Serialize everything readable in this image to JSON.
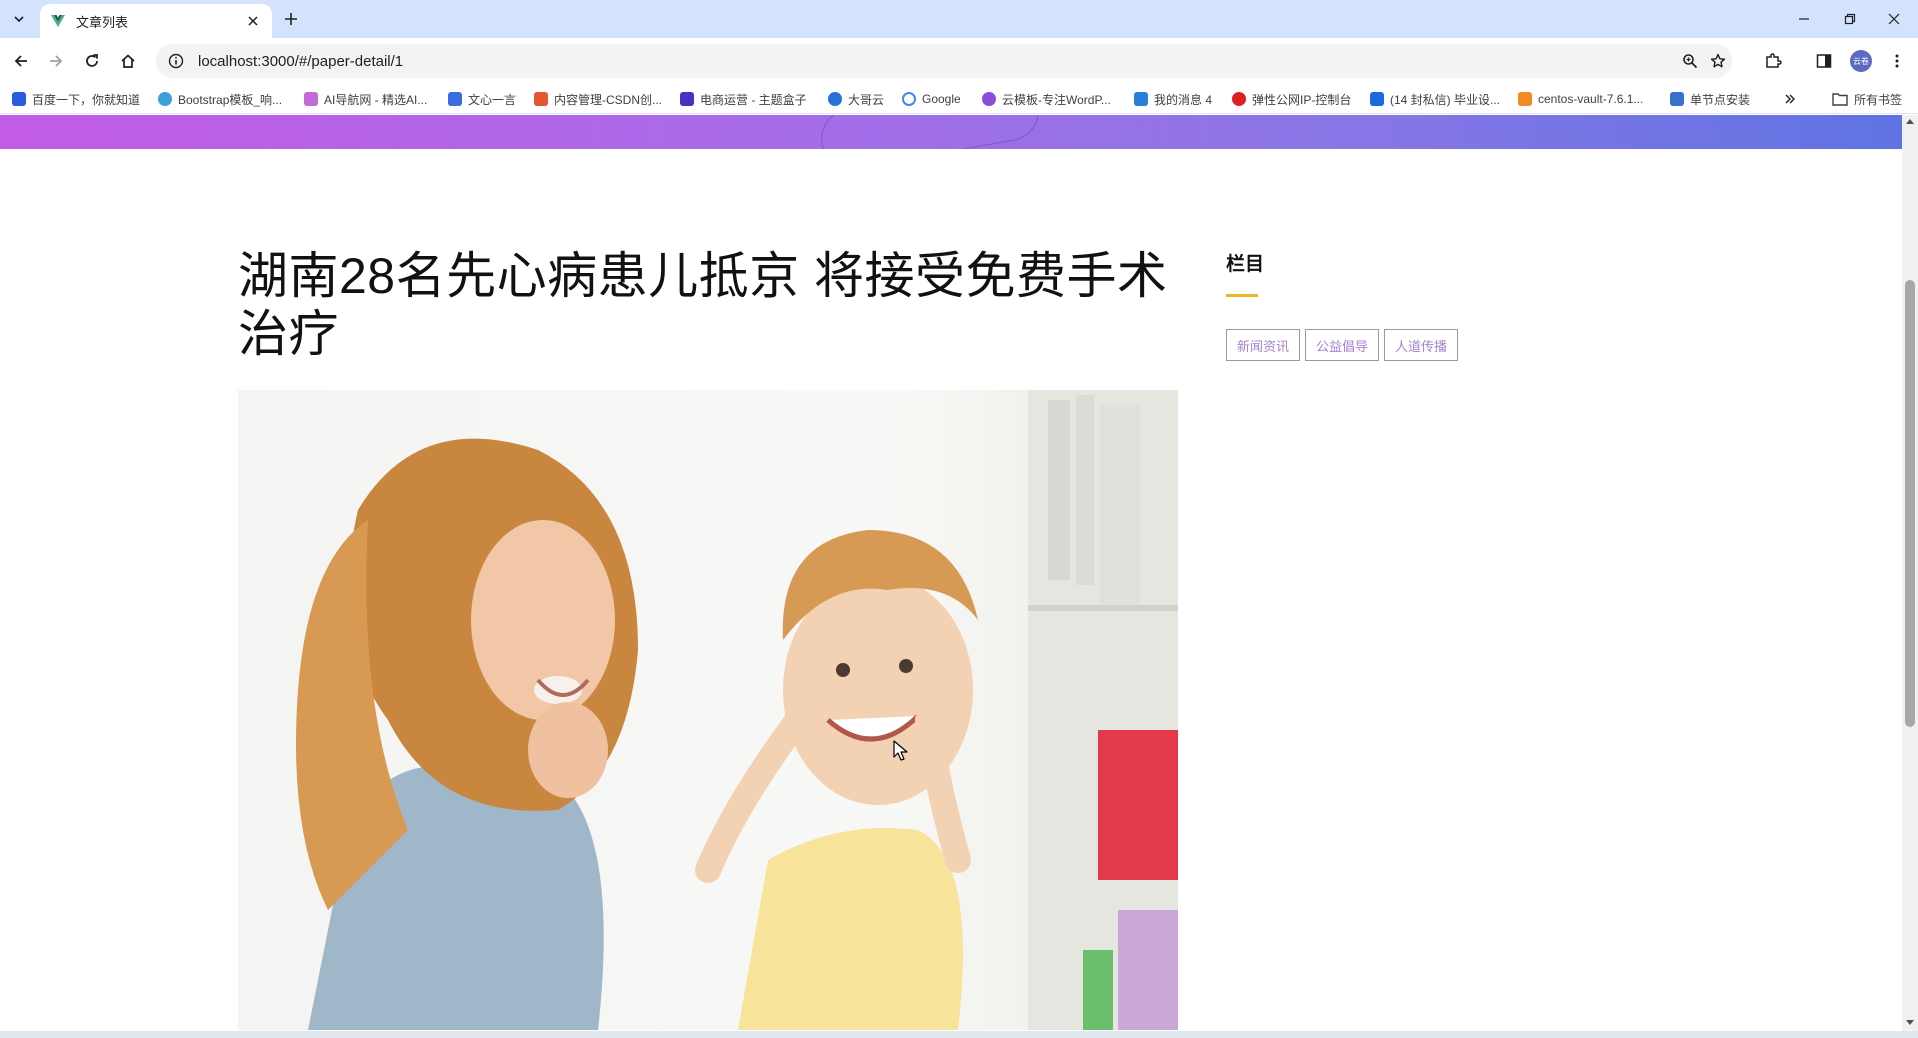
{
  "browser": {
    "tab_title": "文章列表",
    "url": "localhost:3000/#/paper-detail/1",
    "profile_label": "云卷",
    "bookmarks": [
      {
        "label": "百度一下，你就知道",
        "color": "#2b5bde"
      },
      {
        "label": "Bootstrap模板_响...",
        "color": "#3aa0d8"
      },
      {
        "label": "AI导航网 - 精选AI...",
        "color": "#c46ad6"
      },
      {
        "label": "文心一言",
        "color": "#3b6de0"
      },
      {
        "label": "内容管理-CSDN创...",
        "color": "#e4572e"
      },
      {
        "label": "电商运营 - 主题盒子",
        "color": "#4a2fc4"
      },
      {
        "label": "大哥云",
        "color": "#2a6fd6"
      },
      {
        "label": "Google",
        "color": "#4285f4"
      },
      {
        "label": "云模板-专注WordP...",
        "color": "#8a4fd8"
      },
      {
        "label": "我的消息 4",
        "color": "#2a7fd6"
      },
      {
        "label": "弹性公网IP-控制台",
        "color": "#e02020"
      },
      {
        "label": "(14 封私信) 毕业设...",
        "color": "#1a6ae0"
      },
      {
        "label": "centos-vault-7.6.1...",
        "color": "#f08a24"
      },
      {
        "label": "单节点安装",
        "color": "#3a6ecf"
      }
    ],
    "all_bookmarks_label": "所有书签"
  },
  "article": {
    "title": "湖南28名先心病患儿抵京 将接受免费手术治疗"
  },
  "sidebar": {
    "heading": "栏目",
    "tags": [
      "新闻资讯",
      "公益倡导",
      "人道传播"
    ]
  },
  "colors": {
    "accent_underline": "#f0b429",
    "tag_text": "#a982d0",
    "hero_gradient_start": "#c25be6",
    "hero_gradient_end": "#5f73e2"
  }
}
